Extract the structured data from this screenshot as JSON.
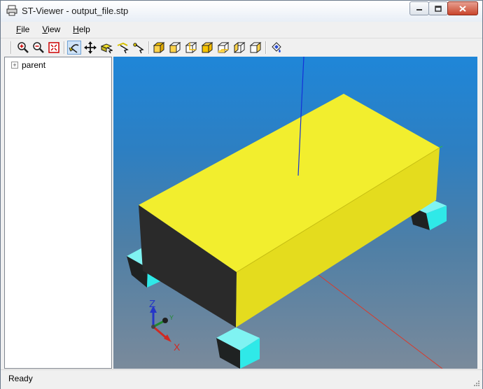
{
  "window": {
    "title": "ST-Viewer - output_file.stp",
    "buttons": [
      "minimize-icon",
      "restore-icon",
      "close-icon"
    ]
  },
  "menu": {
    "items": [
      {
        "label": "File",
        "accel": "F",
        "rest": "ile"
      },
      {
        "label": "View",
        "accel": "V",
        "rest": "iew"
      },
      {
        "label": "Help",
        "accel": "H",
        "rest": "elp"
      }
    ]
  },
  "toolbar": {
    "groups": [
      [
        "zoom-in-icon",
        "zoom-out-icon",
        "fit-all-icon"
      ],
      [
        "rotate-icon",
        "pan-icon",
        "select-face-icon",
        "select-edge-icon",
        "select-vertex-icon"
      ],
      [
        "view-iso-icon",
        "view-front-icon",
        "view-back-icon",
        "view-top-icon",
        "view-bottom-icon",
        "view-left-icon",
        "view-right-icon"
      ],
      [
        "shading-icon"
      ]
    ],
    "active": "rotate-icon"
  },
  "tree": {
    "items": [
      {
        "label": "parent",
        "expander": "+"
      }
    ]
  },
  "viewport": {
    "axis_labels": {
      "z": "Z",
      "y": "Y",
      "x": "X"
    },
    "colors": {
      "box_top": "#f2ee2e",
      "box_side": "#2a2a2a",
      "feet": "#30f0ef",
      "axis_x": "#d93a2b",
      "axis_y": "#2db74a",
      "axis_z": "#1431d8"
    }
  },
  "status": {
    "text": "Ready"
  }
}
